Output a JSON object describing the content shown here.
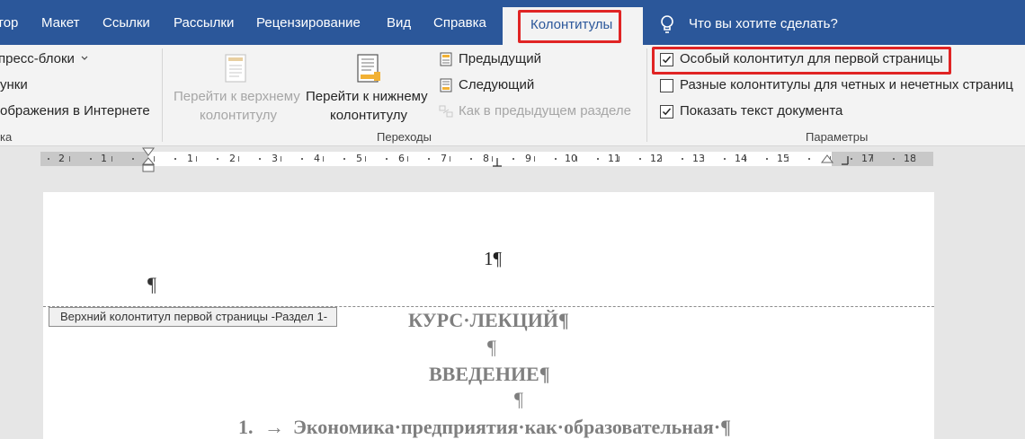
{
  "tabs": {
    "items": [
      {
        "label": "тор"
      },
      {
        "label": "Макет"
      },
      {
        "label": "Ссылки"
      },
      {
        "label": "Рассылки"
      },
      {
        "label": "Рецензирование"
      },
      {
        "label": "Вид"
      },
      {
        "label": "Справка"
      }
    ],
    "active": "Колонтитулы",
    "tell_me": "Что вы хотите сделать?"
  },
  "ribbon": {
    "insert_group": {
      "express_blocks": "пресс-блоки",
      "pictures": "унки",
      "online_pictures": "ображения в Интернете",
      "group_label": "ка"
    },
    "navigation": {
      "goto_header_line1": "Перейти к верхнему",
      "goto_header_line2": "колонтитулу",
      "goto_footer_line1": "Перейти к нижнему",
      "goto_footer_line2": "колонтитулу",
      "previous": "Предыдущий",
      "next": "Следующий",
      "link_to_previous": "Как в предыдущем разделе",
      "group_label": "Переходы"
    },
    "options": {
      "different_first_page": "Особый колонтитул для первой страницы",
      "different_odd_even": "Разные колонтитулы для четных и нечетных страниц",
      "show_document_text": "Показать текст документа",
      "different_first_page_checked": true,
      "different_odd_even_checked": false,
      "show_document_text_checked": true,
      "group_label": "Параметры"
    }
  },
  "ruler": {
    "labels": [
      "2",
      "1",
      "1",
      "2",
      "3",
      "4",
      "5",
      "6",
      "7",
      "8",
      "9",
      "10",
      "11",
      "12",
      "13",
      "14",
      "15",
      "17",
      "18"
    ]
  },
  "document": {
    "page_number": "1¶",
    "header_empty_mark": "¶",
    "header_tag": "Верхний колонтитул первой страницы -Раздел 1-",
    "title": "КУРС·ЛЕКЦИЙ¶",
    "empty_1": "¶",
    "intro": "ВВЕДЕНИЕ¶",
    "empty_2": "¶",
    "list_number": "1.",
    "list_arrow": "→",
    "list_text": "Экономика·предприятия·как·образовательная·¶"
  },
  "colors": {
    "tab_bar": "#2b579a",
    "ribbon_bg": "#f3f3f3",
    "highlight": "#e02424",
    "workspace": "#e6e6e6"
  }
}
